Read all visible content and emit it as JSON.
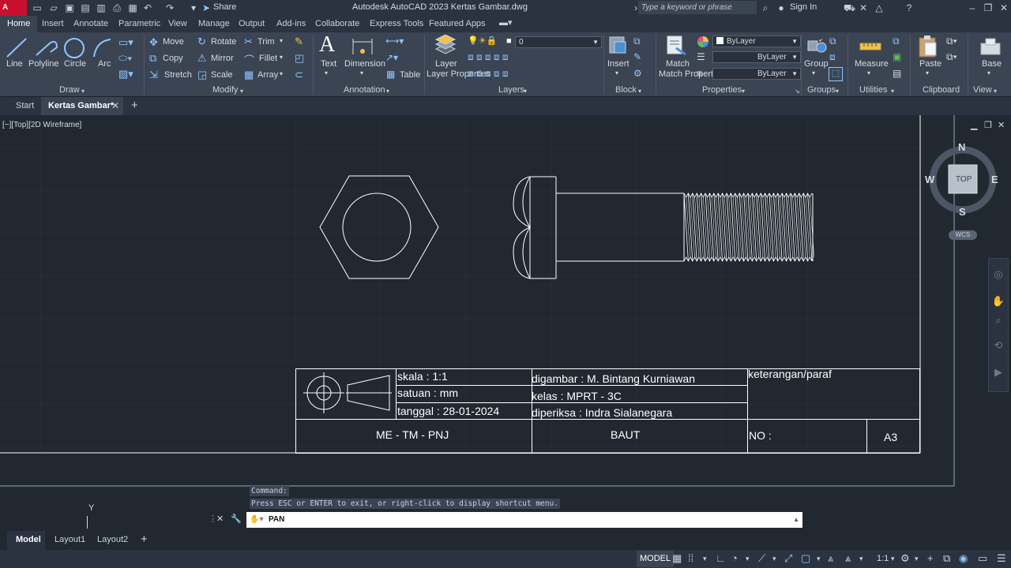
{
  "titlebar": {
    "logo_text": "A CAD",
    "share_label": "Share",
    "title": "Autodesk AutoCAD 2023    Kertas Gambar.dwg",
    "search_placeholder": "Type a keyword or phrase",
    "sign_in": "Sign In"
  },
  "ribbon_tabs": [
    "Home",
    "Insert",
    "Annotate",
    "Parametric",
    "View",
    "Manage",
    "Output",
    "Add-ins",
    "Collaborate",
    "Express Tools",
    "Featured Apps"
  ],
  "ribbon": {
    "draw": {
      "title": "Draw",
      "line": "Line",
      "polyline": "Polyline",
      "circle": "Circle",
      "arc": "Arc"
    },
    "modify": {
      "title": "Modify",
      "move": "Move",
      "rotate": "Rotate",
      "trim": "Trim",
      "copy": "Copy",
      "mirror": "Mirror",
      "fillet": "Fillet",
      "stretch": "Stretch",
      "scale": "Scale",
      "array": "Array"
    },
    "annotation": {
      "title": "Annotation",
      "text": "Text",
      "dimension": "Dimension",
      "table": "Table"
    },
    "layers": {
      "title": "Layers",
      "layer_properties": "Layer Properties",
      "current_layer": "0"
    },
    "block": {
      "title": "Block",
      "insert": "Insert"
    },
    "properties": {
      "title": "Properties",
      "match": "Match Properties",
      "color": "ByLayer",
      "linetype": "ByLayer",
      "lineweight": "ByLayer"
    },
    "groups": {
      "title": "Groups",
      "group": "Group"
    },
    "utilities": {
      "title": "Utilities",
      "measure": "Measure"
    },
    "clipboard": {
      "title": "Clipboard",
      "paste": "Paste"
    },
    "view": {
      "title": "View",
      "base": "Base"
    }
  },
  "file_tabs": {
    "start": "Start",
    "active": "Kertas Gambar*"
  },
  "viewport": {
    "label": "[−][Top][2D Wireframe]",
    "viewcube": {
      "n": "N",
      "s": "S",
      "e": "E",
      "w": "W",
      "top": "TOP",
      "wcs": "WCS"
    },
    "ucs_y": "Y"
  },
  "title_block": {
    "skala": "skala : 1:1",
    "satuan": "satuan : mm",
    "tanggal": "tanggal : 28-01-2024",
    "digambar": "digambar : M. Bintang Kurniawan",
    "kelas": "kelas : MPRT - 3C",
    "diperiksa": "diperiksa : Indra Sialanegara",
    "keterangan": "keterangan/paraf",
    "kode": "ME - TM - PNJ",
    "nama": "BAUT",
    "no": "NO :",
    "kertas": "A3"
  },
  "command": {
    "history_1": "Command:",
    "history_2": "Press ESC or ENTER to exit, or right-click to display shortcut menu.",
    "current": "PAN"
  },
  "layout_tabs": [
    "Model",
    "Layout1",
    "Layout2"
  ],
  "status": {
    "model": "MODEL",
    "scale": "1:1"
  }
}
